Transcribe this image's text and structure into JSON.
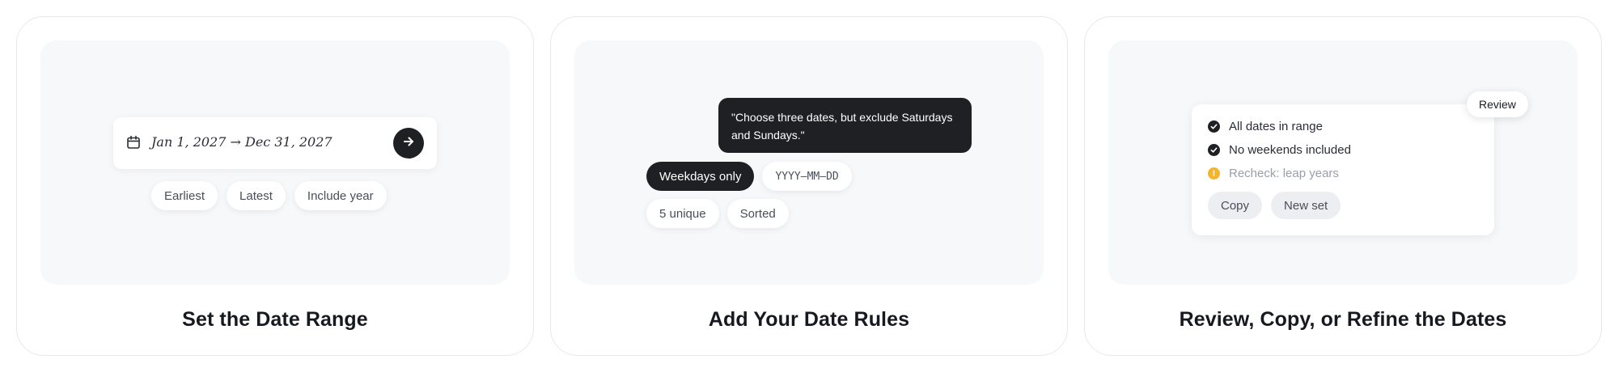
{
  "steps": [
    {
      "title": "Set the Date Range",
      "range_text": "Jan 1, 2027 → Dec 31, 2027",
      "chips": [
        "Earliest",
        "Latest",
        "Include year"
      ]
    },
    {
      "title": "Add Your Date Rules",
      "prompt": "\"Choose three dates, but exclude Saturdays and Sundays.\"",
      "chips_row1": [
        "Weekdays only",
        "YYYY–MM–DD"
      ],
      "chips_row2": [
        "5 unique",
        "Sorted"
      ]
    },
    {
      "title": "Review, Copy, or Refine the Dates",
      "badge": "Review",
      "checks": [
        "All dates in range",
        "No weekends included",
        "Recheck: leap years"
      ],
      "actions": [
        "Copy",
        "New set"
      ]
    }
  ],
  "colors": {
    "dark": "#1f2024",
    "panel": "#f7f8fa",
    "warning": "#f5b42a"
  },
  "icons": [
    "calendar-icon",
    "arrow-right-icon",
    "check-circle-icon",
    "warning-circle-icon"
  ]
}
